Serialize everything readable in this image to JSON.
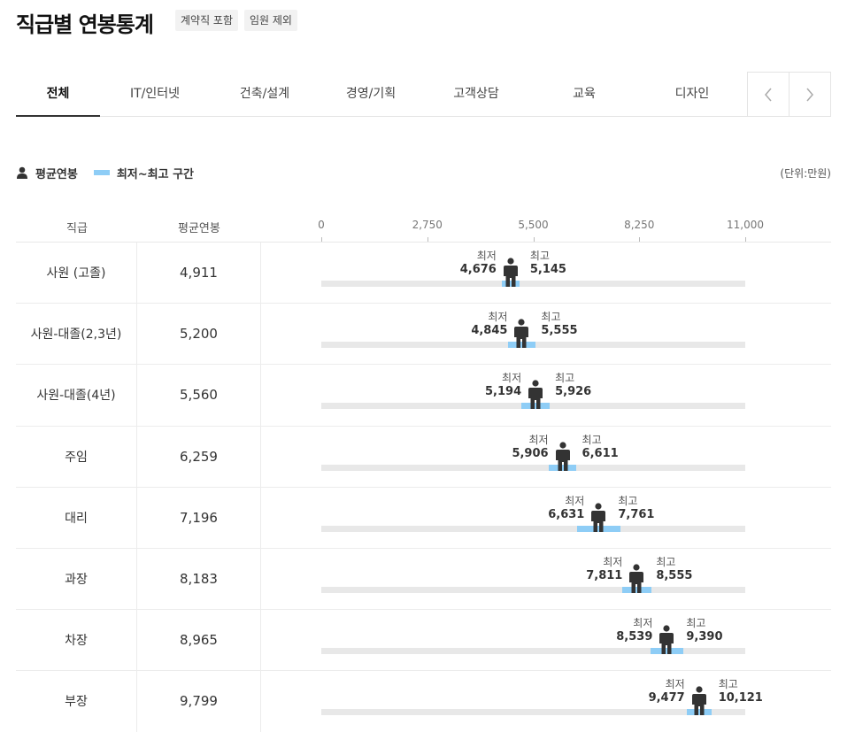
{
  "header": {
    "title": "직급별 연봉통계",
    "tags": [
      "계약직 포함",
      "임원 제외"
    ]
  },
  "tabs": [
    {
      "label": "전체",
      "active": true
    },
    {
      "label": "IT/인터넷",
      "active": false
    },
    {
      "label": "건축/설계",
      "active": false
    },
    {
      "label": "경영/기획",
      "active": false
    },
    {
      "label": "고객상담",
      "active": false
    },
    {
      "label": "교육",
      "active": false
    },
    {
      "label": "디자인",
      "active": false
    }
  ],
  "legend": {
    "avg_label": "평균연봉",
    "range_label": "최저~최고 구간",
    "unit": "(단위:만원)",
    "avg_icon": "person-icon",
    "range_color": "#8ecdf6"
  },
  "table": {
    "col_title": "직급",
    "col_avg": "평균연봉",
    "axis_ticks": [
      "0",
      "2,750",
      "5,500",
      "8,250",
      "11,000"
    ],
    "axis_max": 11000,
    "min_label": "최저",
    "max_label": "최고"
  },
  "chart_data": {
    "type": "bar",
    "xlim": [
      0,
      11000
    ],
    "categories": [
      "사원 (고졸)",
      "사원-대졸(2,3년)",
      "사원-대졸(4년)",
      "주임",
      "대리",
      "과장",
      "차장",
      "부장"
    ],
    "series": [
      {
        "name": "평균연봉",
        "values": [
          4911,
          5200,
          5560,
          6259,
          7196,
          8183,
          8965,
          9799
        ]
      },
      {
        "name": "최저",
        "values": [
          4676,
          4845,
          5194,
          5906,
          6631,
          7811,
          8539,
          9477
        ]
      },
      {
        "name": "최고",
        "values": [
          5145,
          5555,
          5926,
          6611,
          7761,
          8555,
          9390,
          10121
        ]
      }
    ]
  },
  "rows": [
    {
      "title": "사원 (고졸)",
      "avg": "4,911",
      "min": "4,676",
      "max": "5,145",
      "avg_v": 4911,
      "min_v": 4676,
      "max_v": 5145
    },
    {
      "title": "사원-대졸(2,3년)",
      "avg": "5,200",
      "min": "4,845",
      "max": "5,555",
      "avg_v": 5200,
      "min_v": 4845,
      "max_v": 5555
    },
    {
      "title": "사원-대졸(4년)",
      "avg": "5,560",
      "min": "5,194",
      "max": "5,926",
      "avg_v": 5560,
      "min_v": 5194,
      "max_v": 5926
    },
    {
      "title": "주임",
      "avg": "6,259",
      "min": "5,906",
      "max": "6,611",
      "avg_v": 6259,
      "min_v": 5906,
      "max_v": 6611
    },
    {
      "title": "대리",
      "avg": "7,196",
      "min": "6,631",
      "max": "7,761",
      "avg_v": 7196,
      "min_v": 6631,
      "max_v": 7761
    },
    {
      "title": "과장",
      "avg": "8,183",
      "min": "7,811",
      "max": "8,555",
      "avg_v": 8183,
      "min_v": 7811,
      "max_v": 8555
    },
    {
      "title": "차장",
      "avg": "8,965",
      "min": "8,539",
      "max": "9,390",
      "avg_v": 8965,
      "min_v": 8539,
      "max_v": 9390
    },
    {
      "title": "부장",
      "avg": "9,799",
      "min": "9,477",
      "max": "10,121",
      "avg_v": 9799,
      "min_v": 9477,
      "max_v": 10121
    }
  ]
}
